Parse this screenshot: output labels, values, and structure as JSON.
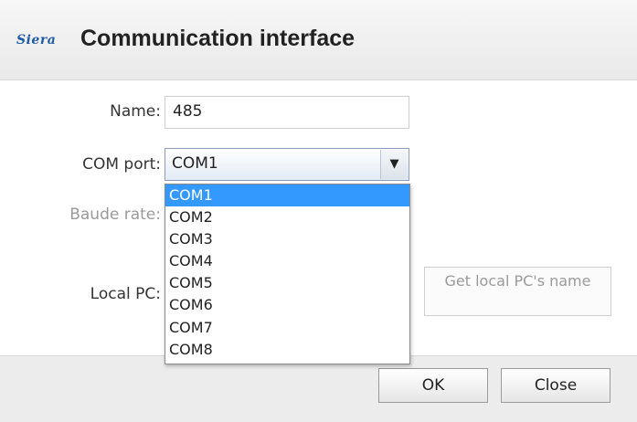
{
  "window": {
    "logo_text": "Siera",
    "title": "Communication interface"
  },
  "form": {
    "name_label": "Name:",
    "name_value": "485",
    "com_port_label": "COM port:",
    "com_port_value": "COM1",
    "baud_rate_label": "Baude rate:",
    "local_pc_label": "Local PC:",
    "get_pc_button_label": "Get local PC's name"
  },
  "dropdown": {
    "options": [
      "COM1",
      "COM2",
      "COM3",
      "COM4",
      "COM5",
      "COM6",
      "COM7",
      "COM8"
    ],
    "selected_index": 0
  },
  "footer": {
    "ok_label": "OK",
    "close_label": "Close"
  },
  "colors": {
    "selection": "#3399ff",
    "title_bar": "#efefef",
    "footer": "#ececec"
  }
}
